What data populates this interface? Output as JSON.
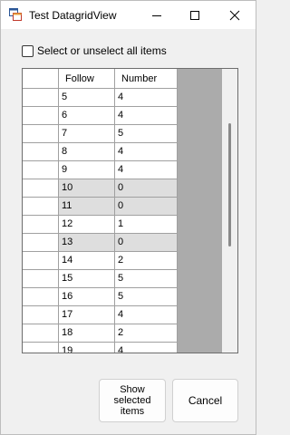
{
  "window": {
    "title": "Test DatagridView"
  },
  "select_all": {
    "label": "Select or unselect all items",
    "checked": false
  },
  "grid": {
    "columns": [
      "Follow",
      "Number"
    ],
    "rows": [
      {
        "follow": "5",
        "number": "4",
        "selected": false
      },
      {
        "follow": "6",
        "number": "4",
        "selected": false
      },
      {
        "follow": "7",
        "number": "5",
        "selected": false
      },
      {
        "follow": "8",
        "number": "4",
        "selected": false
      },
      {
        "follow": "9",
        "number": "4",
        "selected": false
      },
      {
        "follow": "10",
        "number": "0",
        "selected": true
      },
      {
        "follow": "11",
        "number": "0",
        "selected": true
      },
      {
        "follow": "12",
        "number": "1",
        "selected": false
      },
      {
        "follow": "13",
        "number": "0",
        "selected": true
      },
      {
        "follow": "14",
        "number": "2",
        "selected": false
      },
      {
        "follow": "15",
        "number": "5",
        "selected": false
      },
      {
        "follow": "16",
        "number": "5",
        "selected": false
      },
      {
        "follow": "17",
        "number": "4",
        "selected": false
      },
      {
        "follow": "18",
        "number": "2",
        "selected": false
      },
      {
        "follow": "19",
        "number": "4",
        "selected": false
      }
    ]
  },
  "buttons": {
    "show_selected": "Show\nselected\nitems",
    "cancel": "Cancel"
  },
  "icons": {
    "app": "app-window-icon",
    "minimize": "minimize-icon",
    "maximize": "maximize-icon",
    "close": "close-icon"
  },
  "colors": {
    "grid_background": "#ababab",
    "selected_row": "#dedede"
  }
}
